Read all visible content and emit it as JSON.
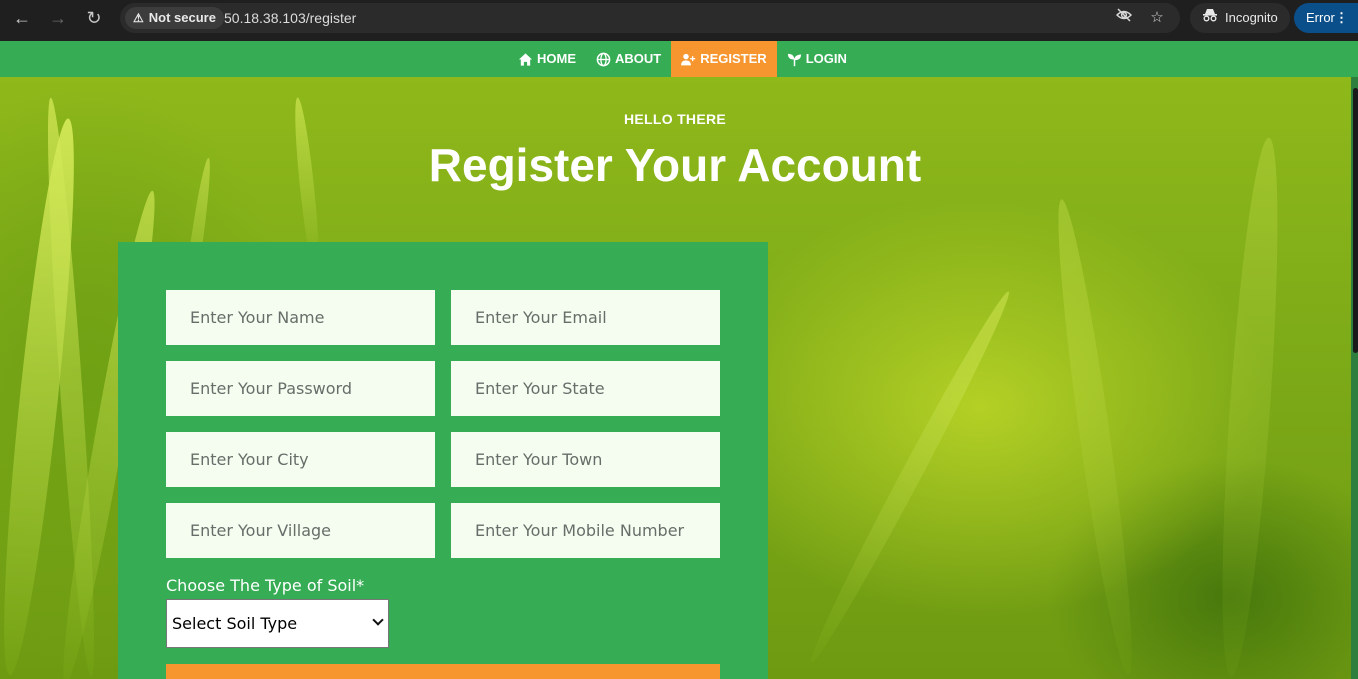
{
  "browser": {
    "security_label": "Not secure",
    "url": "50.18.38.103/register",
    "incognito_label": "Incognito",
    "error_label": "Error"
  },
  "navbar": {
    "items": [
      {
        "label": "HOME",
        "icon": "home-icon"
      },
      {
        "label": "ABOUT",
        "icon": "globe-icon"
      },
      {
        "label": "REGISTER",
        "icon": "user-plus-icon",
        "active": true
      },
      {
        "label": "LOGIN",
        "icon": "seedling-icon"
      }
    ]
  },
  "hero": {
    "eyebrow": "HELLO THERE",
    "title": "Register Your Account"
  },
  "form": {
    "name_placeholder": "Enter Your Name",
    "email_placeholder": "Enter Your Email",
    "password_placeholder": "Enter Your Password",
    "state_placeholder": "Enter Your State",
    "city_placeholder": "Enter Your City",
    "town_placeholder": "Enter Your Town",
    "village_placeholder": "Enter Your Village",
    "mobile_placeholder": "Enter Your Mobile Number",
    "soil_label": "Choose The Type of Soil*",
    "soil_selected": "Select Soil Type"
  },
  "colors": {
    "brand_green": "#36ad55",
    "accent_orange": "#f7962f",
    "field_bg": "#f5fdf1"
  }
}
